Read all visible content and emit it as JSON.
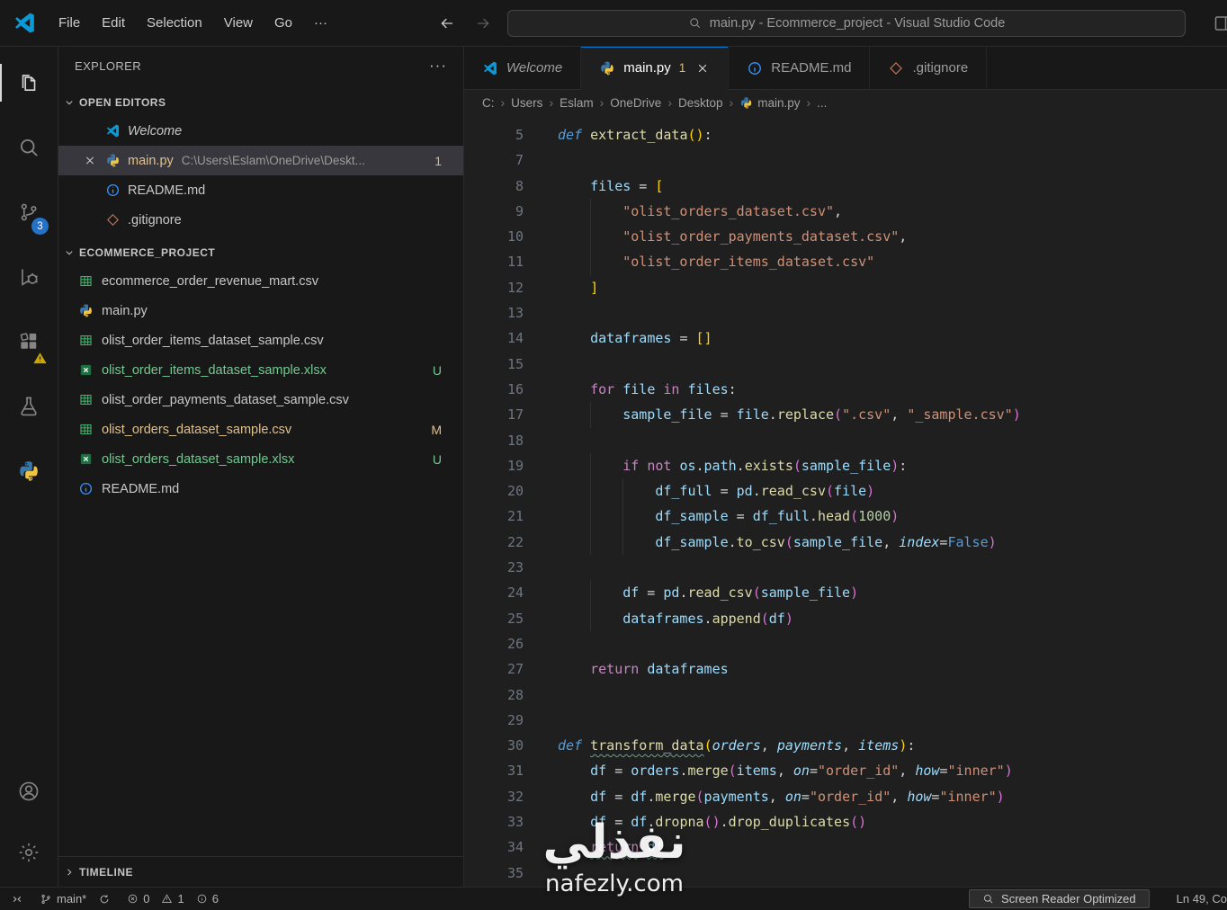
{
  "title_bar": {
    "menus": [
      "File",
      "Edit",
      "Selection",
      "View",
      "Go"
    ],
    "menu_more": "···",
    "command_center": "main.py - Ecommerce_project - Visual Studio Code"
  },
  "activity_bar": {
    "items": [
      {
        "name": "explorer",
        "active": true
      },
      {
        "name": "search"
      },
      {
        "name": "source-control",
        "badge": "3"
      },
      {
        "name": "run-debug"
      },
      {
        "name": "extensions",
        "warning_badge": true
      },
      {
        "name": "testing"
      },
      {
        "name": "python"
      }
    ],
    "bottom_items": [
      {
        "name": "account"
      },
      {
        "name": "settings"
      }
    ]
  },
  "sidebar": {
    "title": "EXPLORER",
    "title_more": "···",
    "open_editors": {
      "label": "OPEN EDITORS",
      "items": [
        {
          "icon": "vscode",
          "label": "Welcome",
          "italic": true
        },
        {
          "icon": "python",
          "label": "main.py",
          "description": "C:\\Users\\Eslam\\OneDrive\\Deskt...",
          "badge": "1",
          "active": true,
          "close": true,
          "modified": true
        },
        {
          "icon": "info",
          "label": "README.md"
        },
        {
          "icon": "git",
          "label": ".gitignore"
        }
      ]
    },
    "project": {
      "label": "ECOMMERCE_PROJECT",
      "files": [
        {
          "icon": "csv",
          "label": "ecommerce_order_revenue_mart.csv"
        },
        {
          "icon": "python",
          "label": "main.py"
        },
        {
          "icon": "csv",
          "label": "olist_order_items_dataset_sample.csv"
        },
        {
          "icon": "xlsx",
          "label": "olist_order_items_dataset_sample.xlsx",
          "badge": "U",
          "state": "untracked"
        },
        {
          "icon": "csv",
          "label": "olist_order_payments_dataset_sample.csv"
        },
        {
          "icon": "csv",
          "label": "olist_orders_dataset_sample.csv",
          "badge": "M",
          "state": "modified"
        },
        {
          "icon": "xlsx",
          "label": "olist_orders_dataset_sample.xlsx",
          "badge": "U",
          "state": "untracked"
        },
        {
          "icon": "info",
          "label": "README.md"
        }
      ]
    },
    "timeline_label": "TIMELINE"
  },
  "editor": {
    "tabs": [
      {
        "icon": "vscode",
        "label": "Welcome",
        "italic": true
      },
      {
        "icon": "python",
        "label": "main.py",
        "badge": "1",
        "close": true,
        "active": true
      },
      {
        "icon": "info",
        "label": "README.md"
      },
      {
        "icon": "git",
        "label": ".gitignore"
      }
    ],
    "breadcrumb": [
      {
        "label": "C:"
      },
      {
        "label": "Users"
      },
      {
        "label": "Eslam"
      },
      {
        "label": "OneDrive"
      },
      {
        "label": "Desktop"
      },
      {
        "label": "main.py",
        "icon": "python"
      },
      {
        "label": "..."
      }
    ],
    "code_lines": [
      {
        "n": "5",
        "indent": 0,
        "tokens": [
          [
            "def",
            "d"
          ],
          [
            " ",
            "o"
          ],
          [
            "extract_data",
            "f"
          ],
          [
            "(",
            "b1"
          ],
          [
            ")",
            "b1"
          ],
          [
            ":",
            "o"
          ]
        ]
      },
      {
        "n": "7",
        "indent": 0,
        "tokens": []
      },
      {
        "n": "8",
        "indent": 1,
        "tokens": [
          [
            "files",
            "v"
          ],
          [
            " = ",
            "o"
          ],
          [
            "[",
            "b1"
          ]
        ]
      },
      {
        "n": "9",
        "indent": 2,
        "tokens": [
          [
            "\"olist_orders_dataset.csv\"",
            "s"
          ],
          [
            ",",
            "o"
          ]
        ]
      },
      {
        "n": "10",
        "indent": 2,
        "tokens": [
          [
            "\"olist_order_payments_dataset.csv\"",
            "s"
          ],
          [
            ",",
            "o"
          ]
        ]
      },
      {
        "n": "11",
        "indent": 2,
        "tokens": [
          [
            "\"olist_order_items_dataset.csv\"",
            "s"
          ]
        ]
      },
      {
        "n": "12",
        "indent": 1,
        "tokens": [
          [
            "]",
            "b1"
          ]
        ]
      },
      {
        "n": "13",
        "indent": 0,
        "tokens": []
      },
      {
        "n": "14",
        "indent": 1,
        "tokens": [
          [
            "dataframes",
            "v"
          ],
          [
            " = ",
            "o"
          ],
          [
            "[]",
            "b1"
          ]
        ]
      },
      {
        "n": "15",
        "indent": 0,
        "tokens": []
      },
      {
        "n": "16",
        "indent": 1,
        "tokens": [
          [
            "for",
            "k"
          ],
          [
            " ",
            "o"
          ],
          [
            "file",
            "v"
          ],
          [
            " ",
            "o"
          ],
          [
            "in",
            "k"
          ],
          [
            " ",
            "o"
          ],
          [
            "files",
            "v"
          ],
          [
            ":",
            "o"
          ]
        ]
      },
      {
        "n": "17",
        "indent": 2,
        "tokens": [
          [
            "sample_file",
            "v"
          ],
          [
            " = ",
            "o"
          ],
          [
            "file",
            "v"
          ],
          [
            ".",
            "o"
          ],
          [
            "replace",
            "f"
          ],
          [
            "(",
            "b2"
          ],
          [
            "\".csv\"",
            "s"
          ],
          [
            ", ",
            "o"
          ],
          [
            "\"_sample.csv\"",
            "s"
          ],
          [
            ")",
            "b2"
          ]
        ]
      },
      {
        "n": "18",
        "indent": 0,
        "tokens": []
      },
      {
        "n": "19",
        "indent": 2,
        "tokens": [
          [
            "if",
            "k"
          ],
          [
            " ",
            "o"
          ],
          [
            "not",
            "k"
          ],
          [
            " ",
            "o"
          ],
          [
            "os",
            "v"
          ],
          [
            ".",
            "o"
          ],
          [
            "path",
            "v"
          ],
          [
            ".",
            "o"
          ],
          [
            "exists",
            "f"
          ],
          [
            "(",
            "b2"
          ],
          [
            "sample_file",
            "v"
          ],
          [
            ")",
            "b2"
          ],
          [
            ":",
            "o"
          ]
        ]
      },
      {
        "n": "20",
        "indent": 3,
        "tokens": [
          [
            "df_full",
            "v"
          ],
          [
            " = ",
            "o"
          ],
          [
            "pd",
            "v"
          ],
          [
            ".",
            "o"
          ],
          [
            "read_csv",
            "f"
          ],
          [
            "(",
            "b2"
          ],
          [
            "file",
            "v"
          ],
          [
            ")",
            "b2"
          ]
        ]
      },
      {
        "n": "21",
        "indent": 3,
        "tokens": [
          [
            "df_sample",
            "v"
          ],
          [
            " = ",
            "o"
          ],
          [
            "df_full",
            "v"
          ],
          [
            ".",
            "o"
          ],
          [
            "head",
            "f"
          ],
          [
            "(",
            "b2"
          ],
          [
            "1000",
            "n"
          ],
          [
            ")",
            "b2"
          ]
        ]
      },
      {
        "n": "22",
        "indent": 3,
        "tokens": [
          [
            "df_sample",
            "v"
          ],
          [
            ".",
            "o"
          ],
          [
            "to_csv",
            "f"
          ],
          [
            "(",
            "b2"
          ],
          [
            "sample_file",
            "v"
          ],
          [
            ", ",
            "o"
          ],
          [
            "index",
            "p"
          ],
          [
            "=",
            "o"
          ],
          [
            "False",
            "c"
          ],
          [
            ")",
            "b2"
          ]
        ]
      },
      {
        "n": "23",
        "indent": 0,
        "tokens": []
      },
      {
        "n": "24",
        "indent": 2,
        "tokens": [
          [
            "df",
            "v"
          ],
          [
            " = ",
            "o"
          ],
          [
            "pd",
            "v"
          ],
          [
            ".",
            "o"
          ],
          [
            "read_csv",
            "f"
          ],
          [
            "(",
            "b2"
          ],
          [
            "sample_file",
            "v"
          ],
          [
            ")",
            "b2"
          ]
        ]
      },
      {
        "n": "25",
        "indent": 2,
        "tokens": [
          [
            "dataframes",
            "v"
          ],
          [
            ".",
            "o"
          ],
          [
            "append",
            "f"
          ],
          [
            "(",
            "b2"
          ],
          [
            "df",
            "v"
          ],
          [
            ")",
            "b2"
          ]
        ]
      },
      {
        "n": "26",
        "indent": 0,
        "tokens": []
      },
      {
        "n": "27",
        "indent": 1,
        "tokens": [
          [
            "return",
            "k"
          ],
          [
            " ",
            "o"
          ],
          [
            "dataframes",
            "v"
          ]
        ]
      },
      {
        "n": "28",
        "indent": 0,
        "tokens": []
      },
      {
        "n": "29",
        "indent": 0,
        "tokens": []
      },
      {
        "n": "30",
        "indent": 0,
        "tokens": [
          [
            "def",
            "d"
          ],
          [
            " ",
            "o"
          ],
          [
            "transform_data",
            "f w"
          ],
          [
            "(",
            "b1"
          ],
          [
            "orders",
            "p"
          ],
          [
            ", ",
            "o"
          ],
          [
            "payments",
            "p"
          ],
          [
            ", ",
            "o"
          ],
          [
            "items",
            "p"
          ],
          [
            ")",
            "b1"
          ],
          [
            ":",
            "o"
          ]
        ]
      },
      {
        "n": "31",
        "indent": 1,
        "tokens": [
          [
            "df",
            "v"
          ],
          [
            " = ",
            "o"
          ],
          [
            "orders",
            "v"
          ],
          [
            ".",
            "o"
          ],
          [
            "merge",
            "f"
          ],
          [
            "(",
            "b2"
          ],
          [
            "items",
            "v"
          ],
          [
            ", ",
            "o"
          ],
          [
            "on",
            "p"
          ],
          [
            "=",
            "o"
          ],
          [
            "\"order_id\"",
            "s"
          ],
          [
            ", ",
            "o"
          ],
          [
            "how",
            "p"
          ],
          [
            "=",
            "o"
          ],
          [
            "\"inner\"",
            "s"
          ],
          [
            ")",
            "b2"
          ]
        ]
      },
      {
        "n": "32",
        "indent": 1,
        "tokens": [
          [
            "df",
            "v"
          ],
          [
            " = ",
            "o"
          ],
          [
            "df",
            "v"
          ],
          [
            ".",
            "o"
          ],
          [
            "merge",
            "f"
          ],
          [
            "(",
            "b2"
          ],
          [
            "payments",
            "v"
          ],
          [
            ", ",
            "o"
          ],
          [
            "on",
            "p"
          ],
          [
            "=",
            "o"
          ],
          [
            "\"order_id\"",
            "s"
          ],
          [
            ", ",
            "o"
          ],
          [
            "how",
            "p"
          ],
          [
            "=",
            "o"
          ],
          [
            "\"inner\"",
            "s"
          ],
          [
            ")",
            "b2"
          ]
        ]
      },
      {
        "n": "33",
        "indent": 1,
        "tokens": [
          [
            "df",
            "v"
          ],
          [
            " = ",
            "o"
          ],
          [
            "df",
            "v"
          ],
          [
            ".",
            "o"
          ],
          [
            "dropna",
            "f"
          ],
          [
            "(",
            "b2"
          ],
          [
            ")",
            "b2"
          ],
          [
            ".",
            "o"
          ],
          [
            "drop_duplicates",
            "f"
          ],
          [
            "(",
            "b2"
          ],
          [
            ")",
            "b2"
          ]
        ]
      },
      {
        "n": "34",
        "indent": 1,
        "tokens": [
          [
            "return",
            "k w"
          ],
          [
            " ",
            "o"
          ],
          [
            "df",
            "v w"
          ]
        ]
      },
      {
        "n": "35",
        "indent": 0,
        "tokens": []
      }
    ]
  },
  "status_bar": {
    "branch": "main*",
    "errors": "0",
    "warnings": "1",
    "infos": "6",
    "screen_reader": "Screen Reader Optimized",
    "cursor": "Ln 49, Co"
  },
  "watermark": {
    "line1": "نفذلي",
    "line2": "nafezly.com"
  },
  "colors": {
    "accent": "#0078d4",
    "modified": "#e2c08d",
    "untracked": "#73c991",
    "scm_badge": "#2472c8"
  }
}
